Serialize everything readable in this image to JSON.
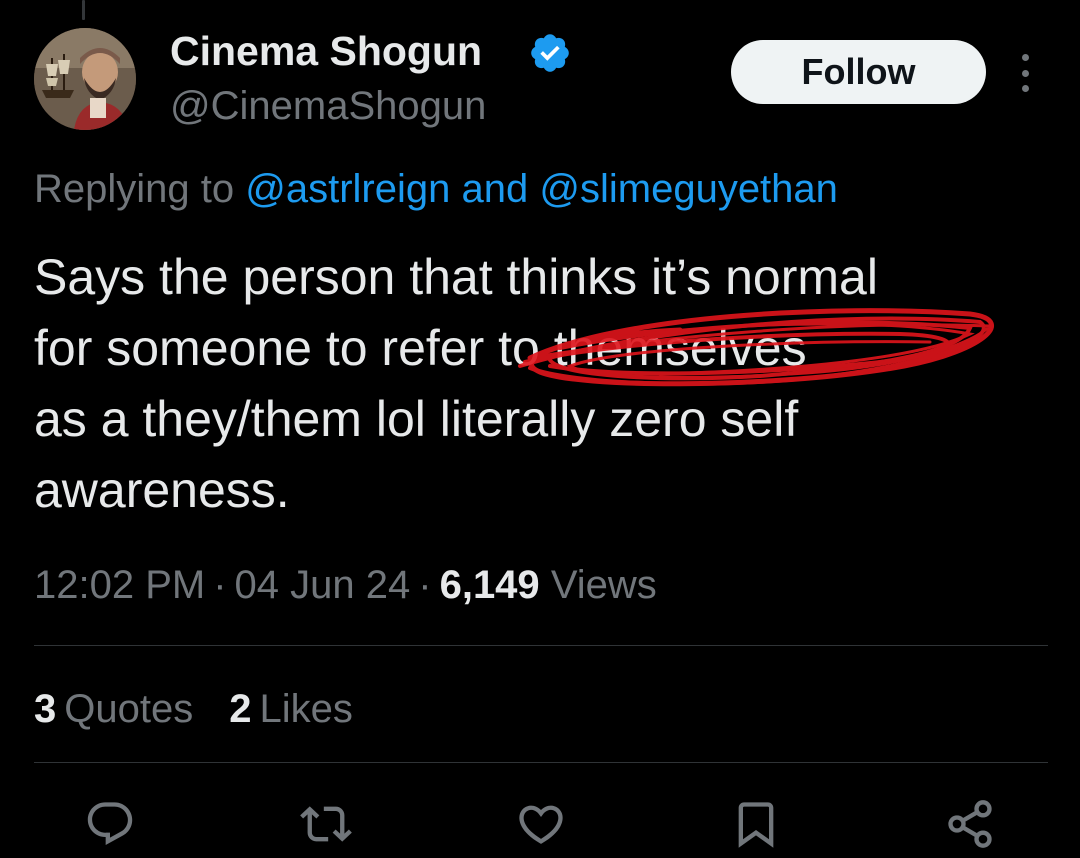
{
  "author": {
    "name": "Cinema Shogun",
    "handle": "@CinemaShogun",
    "verified": true
  },
  "follow_label": "Follow",
  "reply": {
    "prefix": "Replying to",
    "mention_1": "@astrlreign",
    "joiner": "and",
    "mention_2": "@slimeguyethan"
  },
  "tweet": {
    "line_1": "Says the person that thinks it’s normal",
    "line_2": "for someone to refer to themselves",
    "line_3": "as a they/them lol literally zero self",
    "line_4": "awareness."
  },
  "meta": {
    "time": "12:02 PM",
    "date": "04 Jun 24",
    "separator": "·",
    "views_count": "6,149",
    "views_label": "Views"
  },
  "stats": {
    "quotes_count": "3",
    "quotes_label": "Quotes",
    "likes_count": "2",
    "likes_label": "Likes"
  },
  "actions": [
    "reply-icon",
    "retweet-icon",
    "like-icon",
    "bookmark-icon",
    "share-icon"
  ],
  "colors": {
    "background": "#000000",
    "text_primary": "#e7e9ea",
    "text_secondary": "#71767b",
    "link": "#1d9bf0",
    "follow_bg": "#eff3f4",
    "scribble": "#e0141b"
  }
}
